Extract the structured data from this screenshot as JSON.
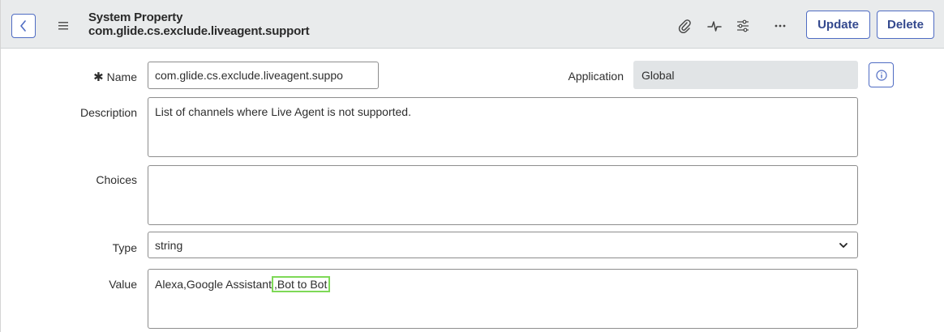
{
  "header": {
    "record_type": "System Property",
    "record_name": "com.glide.cs.exclude.liveagent.support",
    "update_label": "Update",
    "delete_label": "Delete",
    "icons": [
      "back-icon",
      "menu-icon",
      "attachment-icon",
      "activity-icon",
      "settings-sliders-icon",
      "more-icon"
    ]
  },
  "form": {
    "name": {
      "label": "Name",
      "required_marker": "✱",
      "value": "com.glide.cs.exclude.liveagent.suppo"
    },
    "application": {
      "label": "Application",
      "value": "Global"
    },
    "description": {
      "label": "Description",
      "value": "List of channels where Live Agent is not supported."
    },
    "choices": {
      "label": "Choices",
      "value": ""
    },
    "type": {
      "label": "Type",
      "value": "string"
    },
    "value": {
      "label": "Value",
      "value_prefix": "Alexa,Google Assistant",
      "value_highlighted": ",Bot to Bot",
      "highlight_color": "#7ed957"
    }
  },
  "colors": {
    "accent": "#4f6cc3",
    "header_bg": "#e9ebec",
    "readonly_bg": "#e1e4e6"
  }
}
